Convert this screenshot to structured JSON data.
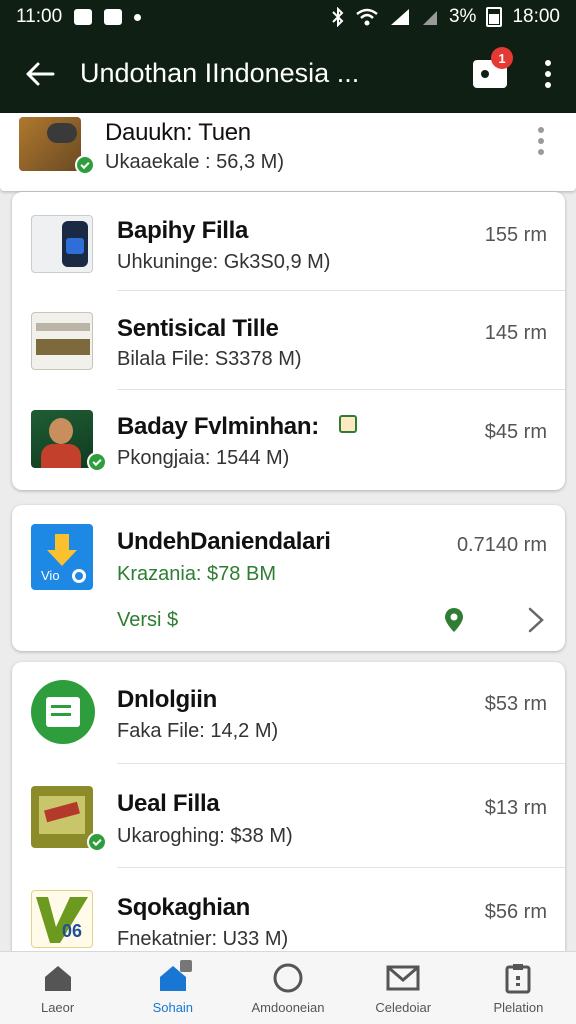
{
  "status_bar": {
    "time": "11:00",
    "battery": "3%",
    "clock_right": "18:00"
  },
  "app_bar": {
    "title": "Undothan IIndonesia ...",
    "notification_count": "1"
  },
  "top_item": {
    "title": "Dauukn: Tuen",
    "subtitle": "Ukaaekale : 56,3 M)"
  },
  "group1": [
    {
      "title": "Bapihy Filla",
      "subtitle": "Uhkuninge: Gk3S0,9 M)",
      "meta": "155 rm",
      "icon": "water-bottle"
    },
    {
      "title": "Sentisical Tille",
      "subtitle": "Bilala File:   S3378 M)",
      "meta": "145 rm",
      "icon": "bench"
    },
    {
      "title": "Baday Fvlminhan:",
      "subtitle": "Pkongjaia: 1544 M)",
      "meta": "$45 rm",
      "icon": "person-photo"
    }
  ],
  "featured": {
    "title": "UndehDaniendalari",
    "subtitle": "Krazania: $78 BM",
    "meta": "0.7140 rm",
    "version_label": "Versi $",
    "app_icon_text": "Vio"
  },
  "group2": [
    {
      "title": "Dnlolgiin",
      "subtitle": "Faka File: 14,2 M)",
      "meta": "$53 rm",
      "icon": "document"
    },
    {
      "title": "Ueal Filla",
      "subtitle": "Ukaroghing: $38 M)",
      "meta": "$13 rm",
      "icon": "flag"
    },
    {
      "title": "Sqokaghian",
      "subtitle": "Fnekatnier: U33 M)",
      "meta": "$56 rm",
      "icon": "v-logo",
      "icon_text": "06"
    }
  ],
  "bottom_nav": [
    {
      "label": "Laeor",
      "icon": "home-outline"
    },
    {
      "label": "Sohain",
      "icon": "home-filled",
      "active": true
    },
    {
      "label": "Amdooneian",
      "icon": "circle"
    },
    {
      "label": "Celedoiar",
      "icon": "mail"
    },
    {
      "label": "Plelation",
      "icon": "clipboard"
    }
  ],
  "colors": {
    "bar": "#0f1f14",
    "accent_green": "#2e7d32",
    "active_nav": "#1976d2",
    "badge": "#e53935"
  }
}
